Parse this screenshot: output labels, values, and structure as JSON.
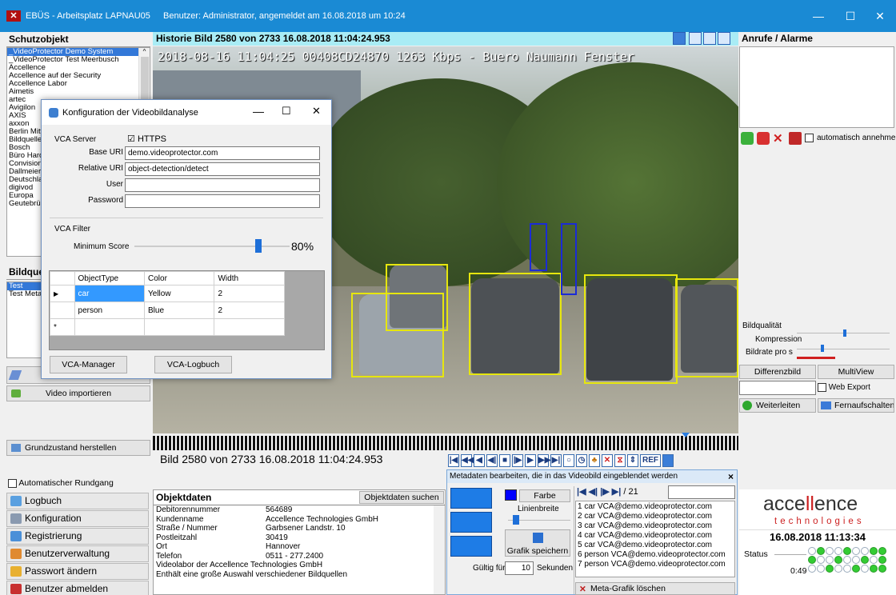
{
  "window": {
    "app_title": "EBÜS - Arbeitsplatz LAPNAU05",
    "user_info": "Benutzer: Administrator, angemeldet am 16.08.2018 um 10:24",
    "minimize": "—",
    "maximize": "☐",
    "close": "✕"
  },
  "schutzobjekt": {
    "title": "Schutzobjekt",
    "items": [
      "_VideoProtector Demo System",
      "_VideoProtector Test Meerbusch",
      "Accellence",
      "Accellence auf der Security",
      "Accellence Labor",
      "Aimetis",
      "artec",
      "Avigilon",
      "AXIS",
      "axxon",
      "Berlin Mitte",
      "Bildquellen",
      "Bosch",
      "Büro Harderweg",
      "Convision",
      "Dallmeier",
      "Deutschland",
      "digivod",
      "Europa",
      "Geutebrück"
    ]
  },
  "bildquellen": {
    "title": "Bildquellen",
    "items": [
      "Test",
      "Test Metadaten"
    ]
  },
  "left_buttons": {
    "import": "Video importieren",
    "reset": "Grundzustand herstellen",
    "auto_tour": "Automatischer Rundgang",
    "logbook": "Logbuch",
    "config": "Konfiguration",
    "registration": "Registrierung",
    "user_admin": "Benutzerverwaltung",
    "password": "Passwort ändern",
    "logout": "Benutzer abmelden"
  },
  "history": {
    "header": "Historie Bild 2580 von 2733   16.08.2018 11:04:24.953",
    "overlay": "2018-08-16 11:04:25 00408CD24870   1263 Kbps - Buero Naumann Fenster",
    "frame_info": "Bild 2580 von 2733  16.08.2018 11:04:24.953",
    "ref": "REF"
  },
  "dialog": {
    "title": "Konfiguration der Videobildanalyse",
    "vca_server": "VCA Server",
    "https": "HTTPS",
    "https_checked": "☑",
    "base_uri_label": "Base URI",
    "base_uri": "demo.videoprotector.com",
    "relative_uri_label": "Relative URI",
    "relative_uri": "object-detection/detect",
    "user_label": "User",
    "user": "",
    "password_label": "Password",
    "password": "",
    "vca_filter": "VCA Filter",
    "min_score_label": "Minimum Score",
    "min_score": "80%",
    "min_score_value": 0.8,
    "columns": [
      "ObjectType",
      "Color",
      "Width"
    ],
    "rows": [
      {
        "type": "car",
        "color": "Yellow",
        "width": "2"
      },
      {
        "type": "person",
        "color": "Blue",
        "width": "2"
      }
    ],
    "new_row_marker": "*",
    "current_row_marker": "▶",
    "manager_btn": "VCA-Manager",
    "logbook_btn": "VCA-Logbuch"
  },
  "objektdaten": {
    "title": "Objektdaten",
    "search": "Objektdaten suchen",
    "fields": [
      [
        "Debitorennummer",
        "564689"
      ],
      [
        "Kundenname",
        "Accellence Technologies GmbH"
      ],
      [
        "Straße / Nummer",
        "Garbsener Landstr. 10"
      ],
      [
        "Postleitzahl",
        "30419"
      ],
      [
        "Ort",
        "Hannover"
      ],
      [
        "Telefon",
        "0511 - 277.2400"
      ]
    ],
    "notes": [
      "Videolabor der Accellence Technologies GmbH",
      "Enthält eine große Auswahl verschiedener Bildquellen"
    ]
  },
  "metadata": {
    "title": "Metadaten bearbeiten, die in das Videobild eingeblendet werden",
    "close": "×",
    "color_btn": "Farbe",
    "line_width": "Linienbreite",
    "save_btn": "Grafik speichern",
    "valid_label": "Gültig für",
    "valid_value": "10",
    "seconds": "Sekunden",
    "nav_count": "/ 21",
    "items": [
      "1 car VCA@demo.videoprotector.com",
      "2 car VCA@demo.videoprotector.com",
      "3 car VCA@demo.videoprotector.com",
      "4 car VCA@demo.videoprotector.com",
      "5 car VCA@demo.videoprotector.com",
      "6 person VCA@demo.videoprotector.com",
      "7 person VCA@demo.videoprotector.com"
    ],
    "delete_btn": "Meta-Grafik löschen",
    "accent": "#0000ff"
  },
  "alarms": {
    "title": "Anrufe / Alarme",
    "auto_accept": "automatisch annehmen"
  },
  "quality": {
    "label": "Bildqualität",
    "compression": "Kompression",
    "framerate": "Bildrate pro s",
    "diff_btn": "Differenzbild",
    "multiview_btn": "MultiView",
    "web_export": "Web Export",
    "forward_btn": "Weiterleiten",
    "remote_btn": "Fernaufschalten"
  },
  "brand": {
    "name_left": "acce",
    "name_mid": "ll",
    "name_right": "ence",
    "sub": "technologies",
    "datetime": "16.08.2018 11:13:34",
    "status_label": "Status",
    "status_time": "0:49",
    "accent": "#cc1f1f"
  }
}
